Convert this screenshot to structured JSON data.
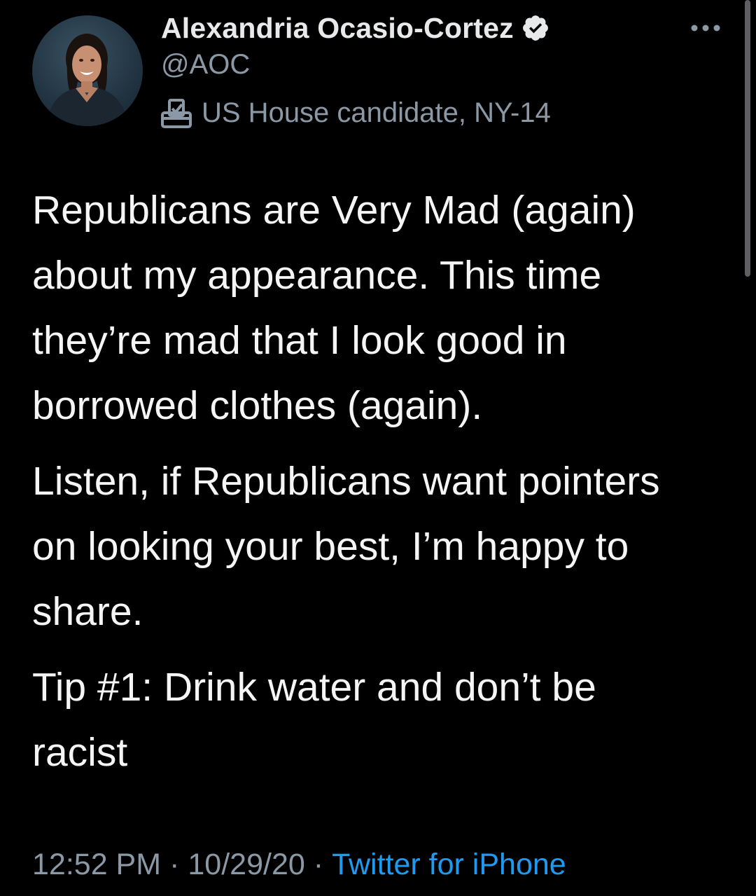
{
  "author": {
    "display_name": "Alexandria Ocasio-Cortez",
    "handle": "@AOC",
    "label": "US House candidate, NY-14",
    "verified_icon": "verified-badge-icon",
    "label_icon": "ballot-box-icon"
  },
  "tweet": {
    "paragraphs": [
      "Republicans are Very Mad (again)\nabout my appearance. This time\nthey’re mad that I look good in\nborrowed clothes (again).",
      "Listen, if Republicans want pointers\non looking your best, I’m happy to\nshare.",
      "Tip #1: Drink water and don’t be\nracist"
    ]
  },
  "meta": {
    "time": "12:52 PM",
    "date": "10/29/20",
    "separator": "·",
    "source": "Twitter for iPhone"
  },
  "colors": {
    "background": "#000000",
    "primary_text": "#e7e9ea",
    "secondary_text": "#8b98a5",
    "link": "#1d9bf0"
  }
}
